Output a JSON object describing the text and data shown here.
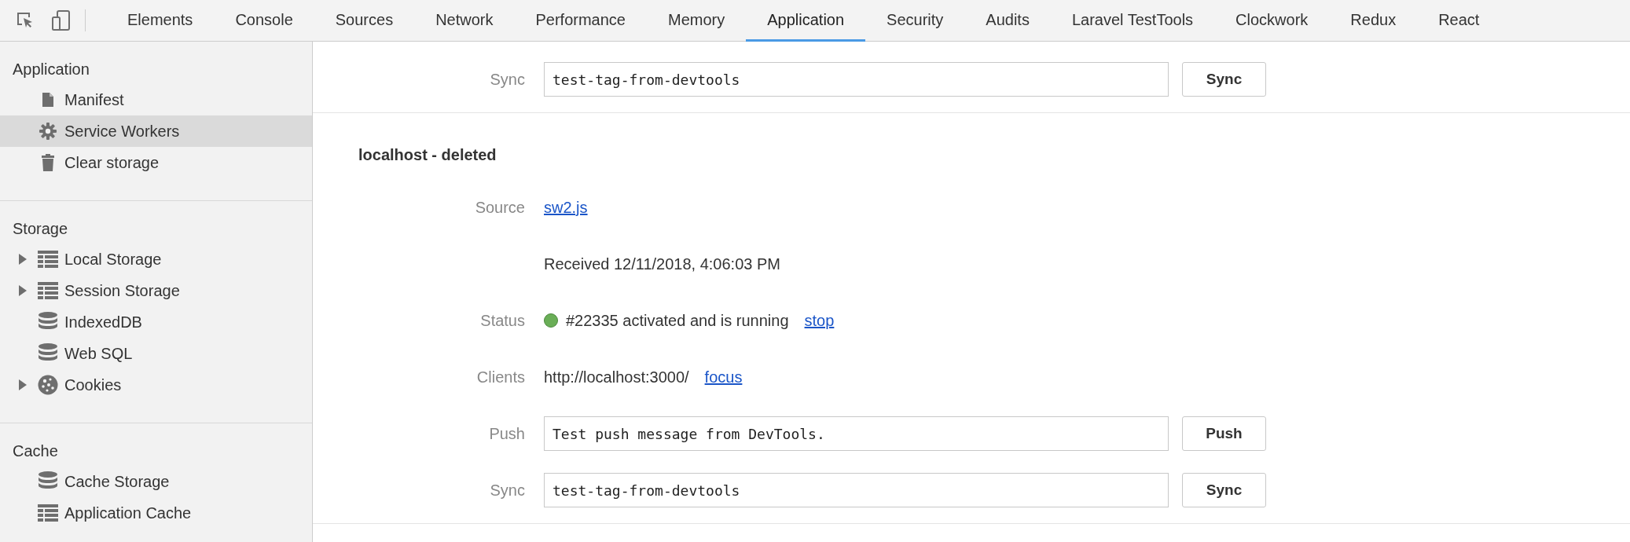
{
  "toolbar": {
    "tabs": [
      {
        "label": "Elements",
        "selected": false
      },
      {
        "label": "Console",
        "selected": false
      },
      {
        "label": "Sources",
        "selected": false
      },
      {
        "label": "Network",
        "selected": false
      },
      {
        "label": "Performance",
        "selected": false
      },
      {
        "label": "Memory",
        "selected": false
      },
      {
        "label": "Application",
        "selected": true
      },
      {
        "label": "Security",
        "selected": false
      },
      {
        "label": "Audits",
        "selected": false
      },
      {
        "label": "Laravel TestTools",
        "selected": false
      },
      {
        "label": "Clockwork",
        "selected": false
      },
      {
        "label": "Redux",
        "selected": false
      },
      {
        "label": "React",
        "selected": false
      }
    ]
  },
  "sidebar": {
    "sections": [
      {
        "title": "Application",
        "items": [
          {
            "label": "Manifest",
            "kind": "file",
            "collapsible": false,
            "selected": false
          },
          {
            "label": "Service Workers",
            "kind": "gear",
            "collapsible": false,
            "selected": true
          },
          {
            "label": "Clear storage",
            "kind": "trash",
            "collapsible": false,
            "selected": false
          }
        ]
      },
      {
        "title": "Storage",
        "items": [
          {
            "label": "Local Storage",
            "kind": "table",
            "collapsible": true,
            "selected": false
          },
          {
            "label": "Session Storage",
            "kind": "table",
            "collapsible": true,
            "selected": false
          },
          {
            "label": "IndexedDB",
            "kind": "database",
            "collapsible": false,
            "selected": false
          },
          {
            "label": "Web SQL",
            "kind": "database",
            "collapsible": false,
            "selected": false
          },
          {
            "label": "Cookies",
            "kind": "cookie",
            "collapsible": true,
            "selected": false
          }
        ]
      },
      {
        "title": "Cache",
        "items": [
          {
            "label": "Cache Storage",
            "kind": "database",
            "collapsible": false,
            "selected": false
          },
          {
            "label": "Application Cache",
            "kind": "table",
            "collapsible": false,
            "selected": false
          }
        ]
      }
    ]
  },
  "workers": [
    {
      "rows": [
        {
          "kind": "field",
          "label": "Sync",
          "value": "test-tag-from-devtools",
          "button": "Sync"
        }
      ]
    },
    {
      "title": "localhost - deleted",
      "rows": [
        {
          "kind": "link",
          "label": "Source",
          "link": "sw2.js"
        },
        {
          "kind": "text",
          "text": "Received 12/11/2018, 4:06:03 PM"
        },
        {
          "kind": "status",
          "label": "Status",
          "running": true,
          "text": "#22335 activated and is running",
          "link": "stop"
        },
        {
          "kind": "clients",
          "label": "Clients",
          "text": "http://localhost:3000/",
          "link": "focus"
        },
        {
          "kind": "field",
          "label": "Push",
          "value": "Test push message from DevTools.",
          "button": "Push"
        },
        {
          "kind": "field",
          "label": "Sync",
          "value": "test-tag-from-devtools",
          "button": "Sync"
        }
      ]
    }
  ]
}
